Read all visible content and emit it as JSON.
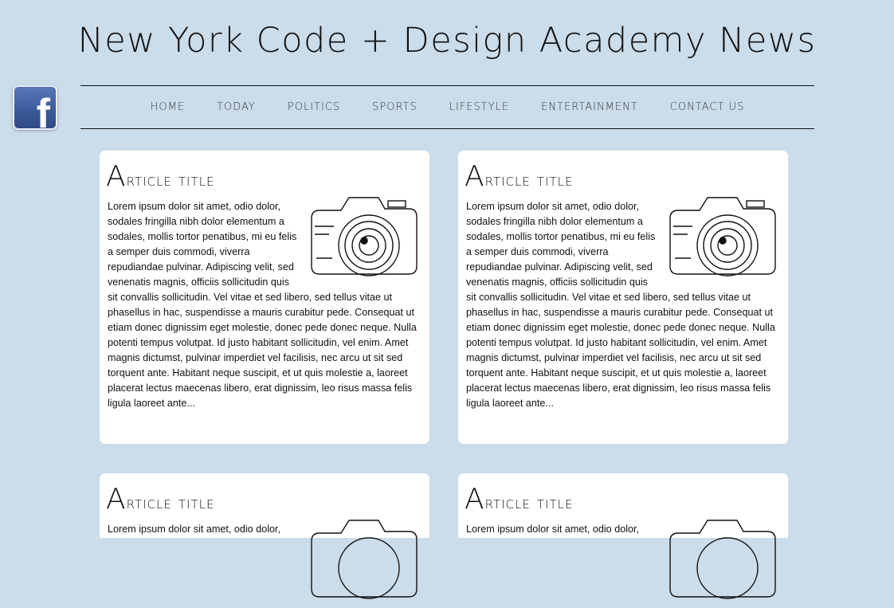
{
  "header": {
    "title": "New York Code + Design Academy News"
  },
  "social": {
    "facebook_icon": "facebook-icon"
  },
  "nav": {
    "items": [
      {
        "label": "HOME"
      },
      {
        "label": "TODAY"
      },
      {
        "label": "POLITICS"
      },
      {
        "label": "SPORTS"
      },
      {
        "label": "LIFESTYLE"
      },
      {
        "label": "ENTERTAINMENT"
      },
      {
        "label": "CONTACT US"
      }
    ]
  },
  "articles": [
    {
      "title": "Article title",
      "image": "camera-icon",
      "body": "Lorem ipsum dolor sit amet, odio dolor, sodales fringilla nibh dolor elementum a sodales, mollis tortor penatibus, mi eu felis a semper duis commodi, viverra repudiandae pulvinar. Adipiscing velit, sed venenatis magnis, officiis sollicitudin quis sit convallis sollicitudin. Vel vitae et sed libero, sed tellus vitae ut phasellus in hac, suspendisse a mauris curabitur pede. Consequat ut etiam donec dignissim eget molestie, donec pede donec neque. Nulla potenti tempus volutpat. Id justo habitant sollicitudin, vel enim. Amet magnis dictumst, pulvinar imperdiet vel facilisis, nec arcu ut sit sed torquent ante. Habitant neque suscipit, et ut quis molestie a, laoreet placerat lectus maecenas libero, erat dignissim, leo risus massa felis ligula laoreet ante..."
    },
    {
      "title": "Article title",
      "image": "camera-icon",
      "body": "Lorem ipsum dolor sit amet, odio dolor, sodales fringilla nibh dolor elementum a sodales, mollis tortor penatibus, mi eu felis a semper duis commodi, viverra repudiandae pulvinar. Adipiscing velit, sed venenatis magnis, officiis sollicitudin quis sit convallis sollicitudin. Vel vitae et sed libero, sed tellus vitae ut phasellus in hac, suspendisse a mauris curabitur pede. Consequat ut etiam donec dignissim eget molestie, donec pede donec neque. Nulla potenti tempus volutpat. Id justo habitant sollicitudin, vel enim. Amet magnis dictumst, pulvinar imperdiet vel facilisis, nec arcu ut sit sed torquent ante. Habitant neque suscipit, et ut quis molestie a, laoreet placerat lectus maecenas libero, erat dignissim, leo risus massa felis ligula laoreet ante..."
    },
    {
      "title": "Article title",
      "image": "camera-icon",
      "body": "Lorem ipsum dolor sit amet, odio dolor,"
    },
    {
      "title": "Article title",
      "image": "camera-icon",
      "body": "Lorem ipsum dolor sit amet, odio dolor,"
    }
  ],
  "colors": {
    "background": "#cbdcea",
    "card": "#ffffff",
    "facebook": "#3b5998"
  }
}
